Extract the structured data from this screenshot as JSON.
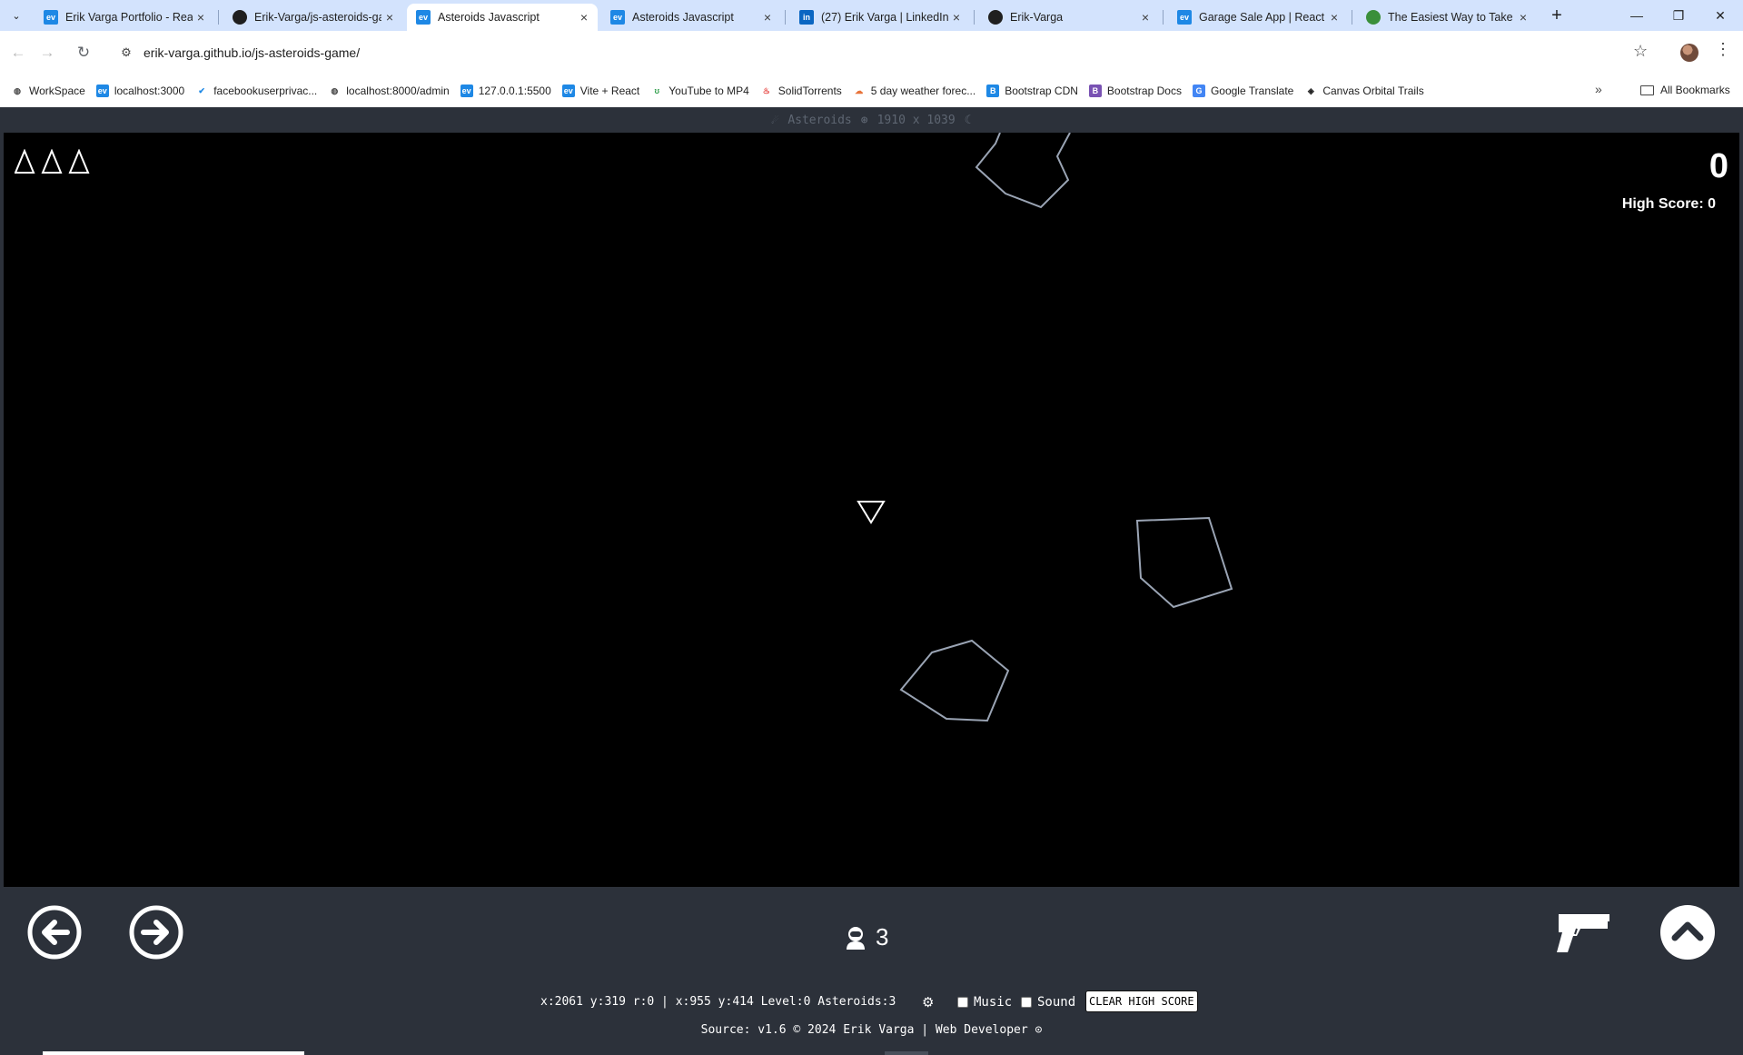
{
  "browser": {
    "tabs": [
      {
        "title": "Erik Varga Portfolio - React",
        "favicon": "ev-icon",
        "active": false
      },
      {
        "title": "Erik-Varga/js-asteroids-game",
        "favicon": "github-icon",
        "active": false
      },
      {
        "title": "Asteroids Javascript",
        "favicon": "ev-icon",
        "active": true
      },
      {
        "title": "Asteroids Javascript",
        "favicon": "ev-icon",
        "active": false
      },
      {
        "title": "(27) Erik Varga | LinkedIn",
        "favicon": "linkedin-icon",
        "active": false
      },
      {
        "title": "Erik-Varga",
        "favicon": "github-icon",
        "active": false
      },
      {
        "title": "Garage Sale App | React",
        "favicon": "ev-icon",
        "active": false
      },
      {
        "title": "The Easiest Way to Take a",
        "favicon": "green-circle-icon",
        "active": false
      }
    ],
    "url": "erik-varga.github.io/js-asteroids-game/",
    "bookmarks": [
      {
        "label": "WorkSpace",
        "icon": "globe-icon"
      },
      {
        "label": "localhost:3000",
        "icon": "ev-icon"
      },
      {
        "label": "facebookuserprivac...",
        "icon": "check-icon"
      },
      {
        "label": "localhost:8000/admin",
        "icon": "globe-icon"
      },
      {
        "label": "127.0.0.1:5500",
        "icon": "ev-icon"
      },
      {
        "label": "Vite + React",
        "icon": "ev-icon"
      },
      {
        "label": "YouTube to MP4",
        "icon": "green-swirl-icon"
      },
      {
        "label": "SolidTorrents",
        "icon": "flame-icon"
      },
      {
        "label": "5 day weather forec...",
        "icon": "weather-icon"
      },
      {
        "label": "Bootstrap CDN",
        "icon": "bootstrap-icon"
      },
      {
        "label": "Bootstrap Docs",
        "icon": "bootstrap-purple-icon"
      },
      {
        "label": "Google Translate",
        "icon": "translate-icon"
      },
      {
        "label": "Canvas Orbital Trails",
        "icon": "codepen-icon"
      }
    ],
    "all_bookmarks": "All Bookmarks"
  },
  "page": {
    "title": "Asteroids",
    "dimensions": "1910 x 1039",
    "score": "0",
    "high_score": "High Score: 0",
    "lives": 3,
    "players": "3",
    "status": "x:2061 y:319 r:0 | x:955 y:414 Level:0 Asteroids:3",
    "music_label": "Music",
    "sound_label": "Sound",
    "clear_label": "CLEAR HIGH SCORE",
    "footer": "Source: v1.6 © 2024 Erik Varga | Web Developer",
    "colors": {
      "background": "#2c313a",
      "field": "#000000",
      "asteroid_stroke": "#9aa4b4",
      "ship": "#ffffff"
    }
  }
}
